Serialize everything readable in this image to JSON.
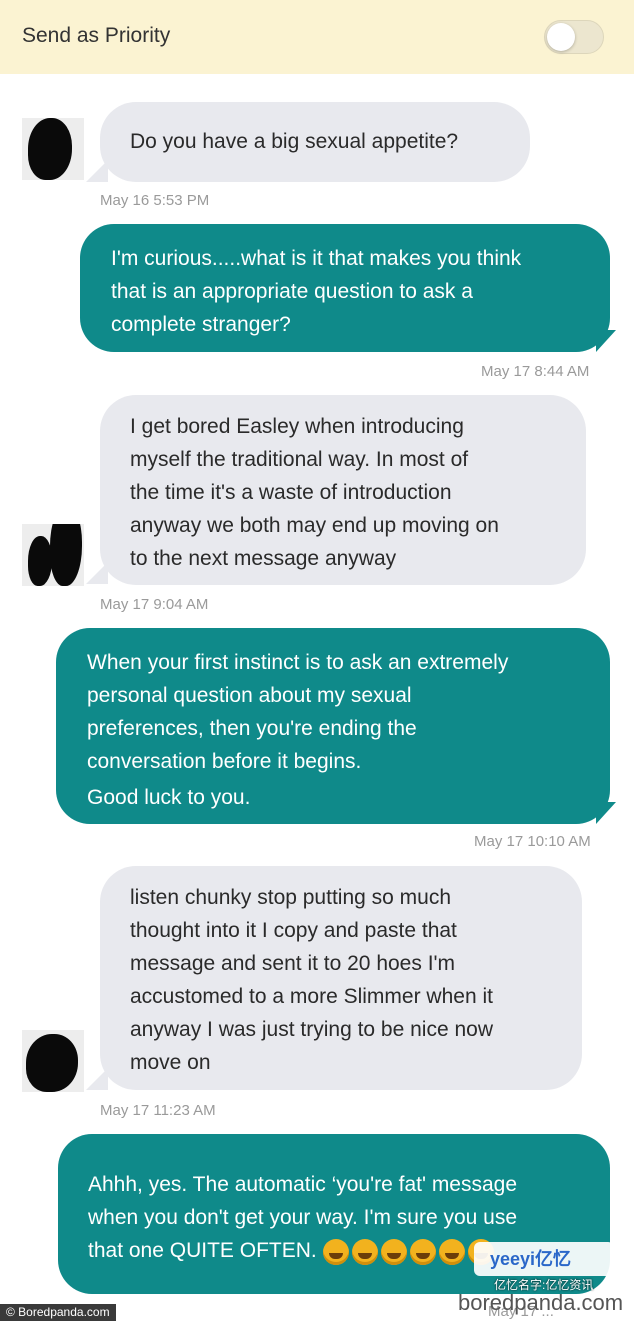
{
  "header": {
    "priority_label": "Send as Priority",
    "priority_toggle_on": false
  },
  "messages": [
    {
      "direction": "in",
      "lines": [
        "Do you have a big sexual appetite?"
      ],
      "time": "May 16 5:53 PM"
    },
    {
      "direction": "out",
      "lines": [
        "I'm curious.....what is it that makes you think",
        "that is an appropriate question to ask a",
        "complete stranger?"
      ],
      "time": "May 17 8:44 AM"
    },
    {
      "direction": "in",
      "lines": [
        "I get bored Easley when introducing",
        "myself the traditional way. In most of",
        "the time it's a waste of introduction",
        "anyway we both may end up moving on",
        "to the next message anyway"
      ],
      "time": "May 17 9:04 AM"
    },
    {
      "direction": "out",
      "lines": [
        "When your first instinct is to ask an extremely",
        "personal question about my sexual",
        "preferences, then you're ending the",
        "conversation before it begins.",
        "Good luck to you."
      ],
      "time": "May 17 10:10 AM"
    },
    {
      "direction": "in",
      "lines": [
        "listen chunky stop putting so much",
        "thought into it I copy and paste that",
        "message and sent it to 20 hoes I'm",
        "accustomed to a more Slimmer when it",
        "anyway I was just trying to be nice now",
        "move on"
      ],
      "time": "May 17 11:23 AM"
    },
    {
      "direction": "out",
      "lines": [
        "Ahhh, yes. The automatic ‘you're fat' message",
        "when you don't get your way. I'm sure you use",
        "that one QUITE OFTEN."
      ],
      "emoji": [
        "face-with-tears-of-joy",
        "rolling-on-floor-laughing",
        "face-with-tears-of-joy",
        "rolling-on-floor-laughing",
        "face-with-tears-of-joy",
        "rolling-on-floor-laughing"
      ],
      "time": "May 17 ..."
    }
  ],
  "watermarks": {
    "yeeyi": "yeeyi亿忆",
    "yeeyi_sub": "亿忆名字:亿忆资讯",
    "boredpanda": "boredpanda.com",
    "credit": "© Boredpanda.com"
  }
}
